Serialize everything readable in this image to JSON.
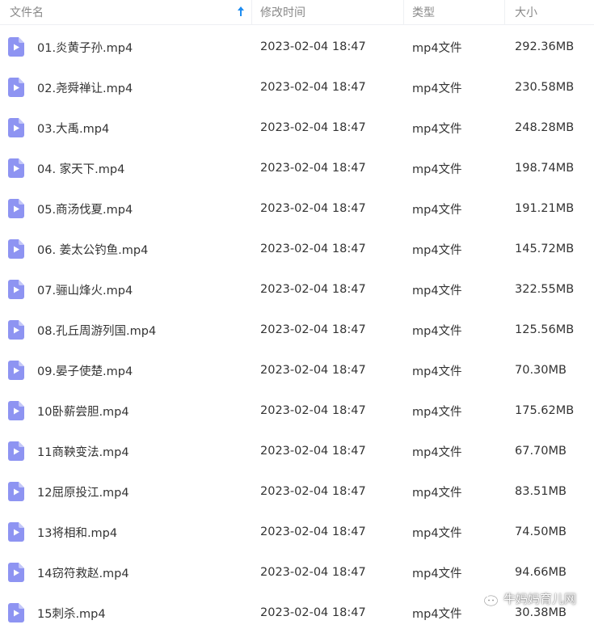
{
  "header": {
    "name": "文件名",
    "date": "修改时间",
    "type": "类型",
    "size": "大小"
  },
  "colors": {
    "accent": "#1e8cf0",
    "file_icon": "#8e94f2",
    "header_text": "#888888"
  },
  "files": [
    {
      "name": "01.炎黄子孙.mp4",
      "date": "2023-02-04 18:47",
      "type": "mp4文件",
      "size": "292.36MB"
    },
    {
      "name": "02.尧舜禅让.mp4",
      "date": "2023-02-04 18:47",
      "type": "mp4文件",
      "size": "230.58MB"
    },
    {
      "name": "03.大禹.mp4",
      "date": "2023-02-04 18:47",
      "type": "mp4文件",
      "size": "248.28MB"
    },
    {
      "name": "04. 家天下.mp4",
      "date": "2023-02-04 18:47",
      "type": "mp4文件",
      "size": "198.74MB"
    },
    {
      "name": "05.商汤伐夏.mp4",
      "date": "2023-02-04 18:47",
      "type": "mp4文件",
      "size": "191.21MB"
    },
    {
      "name": "06. 姜太公钓鱼.mp4",
      "date": "2023-02-04 18:47",
      "type": "mp4文件",
      "size": "145.72MB"
    },
    {
      "name": "07.骊山烽火.mp4",
      "date": "2023-02-04 18:47",
      "type": "mp4文件",
      "size": "322.55MB"
    },
    {
      "name": "08.孔丘周游列国.mp4",
      "date": "2023-02-04 18:47",
      "type": "mp4文件",
      "size": "125.56MB"
    },
    {
      "name": "09.晏子使楚.mp4",
      "date": "2023-02-04 18:47",
      "type": "mp4文件",
      "size": "70.30MB"
    },
    {
      "name": "10卧薪尝胆.mp4",
      "date": "2023-02-04 18:47",
      "type": "mp4文件",
      "size": "175.62MB"
    },
    {
      "name": "11商鞅变法.mp4",
      "date": "2023-02-04 18:47",
      "type": "mp4文件",
      "size": "67.70MB"
    },
    {
      "name": "12屈原投江.mp4",
      "date": "2023-02-04 18:47",
      "type": "mp4文件",
      "size": "83.51MB"
    },
    {
      "name": "13将相和.mp4",
      "date": "2023-02-04 18:47",
      "type": "mp4文件",
      "size": "74.50MB"
    },
    {
      "name": "14窃符救赵.mp4",
      "date": "2023-02-04 18:47",
      "type": "mp4文件",
      "size": "94.66MB"
    },
    {
      "name": "15刺杀.mp4",
      "date": "2023-02-04 18:47",
      "type": "mp4文件",
      "size": "30.38MB"
    }
  ],
  "watermark": {
    "text": "牛妈妈育儿网",
    "icon": "wechat-icon"
  }
}
